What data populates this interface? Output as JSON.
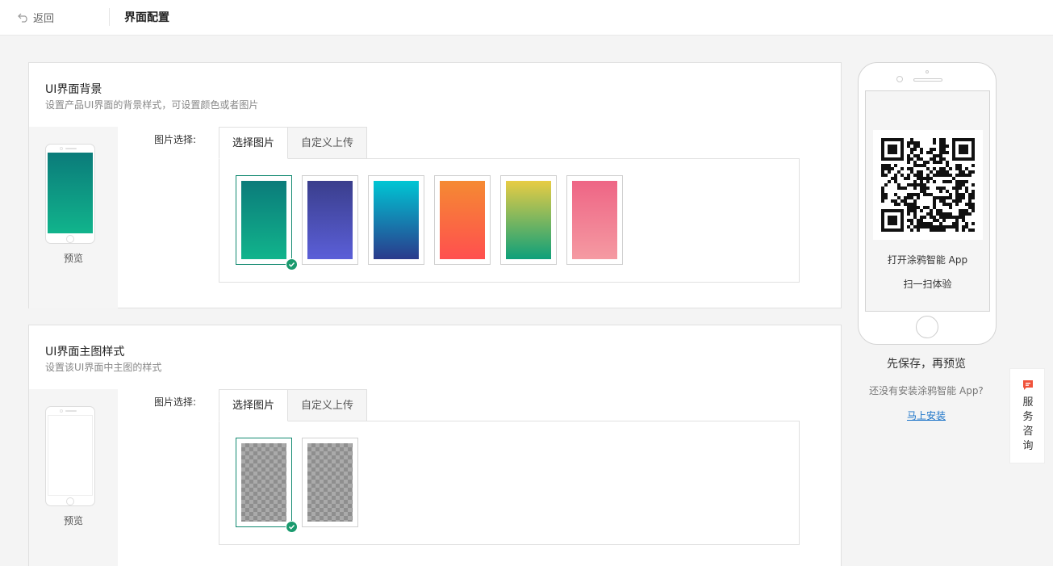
{
  "header": {
    "back_label": "返回",
    "title": "界面配置"
  },
  "sections": [
    {
      "title": "UI界面背景",
      "subtitle": "设置产品UI界面的背景样式，可设置颜色或者图片",
      "preview_label": "预览",
      "field_label": "图片选择:",
      "tabs": [
        "选择图片",
        "自定义上传"
      ],
      "selected_index": 0,
      "options": [
        {
          "gradient": [
            "#0b7b7a",
            "#11b48c"
          ]
        },
        {
          "gradient": [
            "#3a3e8c",
            "#5b5fd8"
          ]
        },
        {
          "gradient": [
            "#00c6d4",
            "#2a3a8c"
          ]
        },
        {
          "gradient": [
            "#f58a32",
            "#ff4f4f"
          ]
        },
        {
          "gradient": [
            "#e8cc44",
            "#0ea07a"
          ]
        },
        {
          "gradient": [
            "#ee6585",
            "#f59aa2"
          ]
        }
      ]
    },
    {
      "title": "UI界面主图样式",
      "subtitle": "设置该UI界面中主图的样式",
      "preview_label": "预览",
      "field_label": "图片选择:",
      "tabs": [
        "选择图片",
        "自定义上传"
      ],
      "selected_index": 0,
      "options": [
        {
          "pattern": "transparent"
        },
        {
          "pattern": "transparent"
        }
      ]
    }
  ],
  "phone_preview": {
    "line1": "打开涂鸦智能 App",
    "line2": "扫一扫体验"
  },
  "save_tip": "先保存，再预览",
  "install_question": "还没有安装涂鸦智能 App?",
  "install_link": "马上安装",
  "service": {
    "chars": [
      "服",
      "务",
      "咨",
      "询"
    ],
    "accent": "#f0533c"
  },
  "colors": {
    "selected_border": "#138a71",
    "check": "#1a9a6e",
    "link": "#1a73c8"
  }
}
